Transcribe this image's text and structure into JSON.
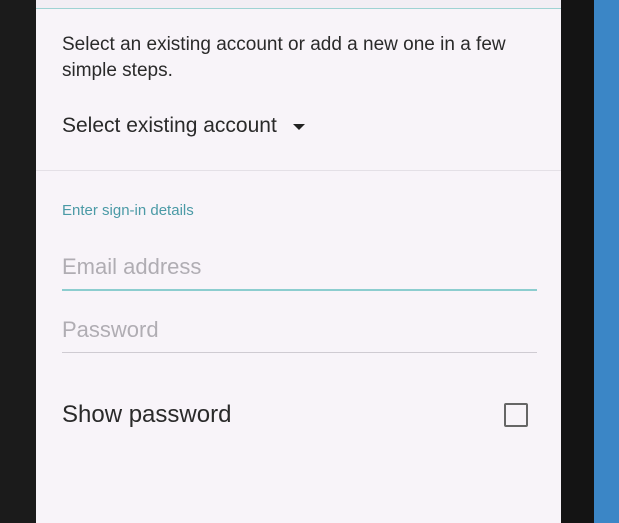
{
  "account": {
    "intro": "Select an existing account or add a new one in a few simple steps.",
    "select_label": "Select existing account"
  },
  "signin": {
    "heading": "Enter sign-in details",
    "email_placeholder": "Email address",
    "email_value": "",
    "password_placeholder": "Password",
    "password_value": "",
    "show_password_label": "Show password",
    "show_password_checked": false
  },
  "icons": {
    "dropdown": "chevron-down-icon",
    "checkbox": "checkbox-unchecked-icon"
  },
  "colors": {
    "accent": "#4b9aa6",
    "screen_background": "#f8f4f9",
    "focus_underline": "#8ccdcf",
    "side_strip": "#3b86c6"
  }
}
